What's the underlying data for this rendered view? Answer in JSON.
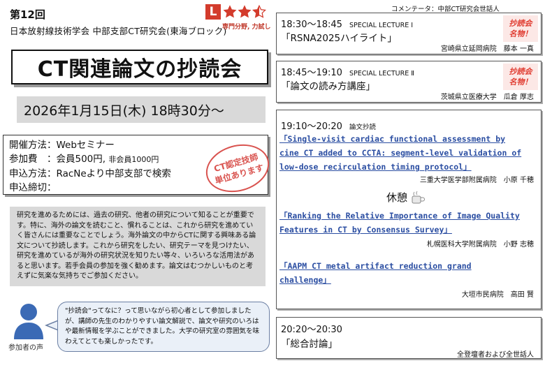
{
  "header": {
    "session_no": "第12回",
    "organizer": "日本放射線技術学会 中部支部CT研究会(東海ブロック)",
    "level_letter": "L",
    "level_stars": 2.5,
    "level_caption": "専門分野, 力試し"
  },
  "main_title": "CT関連論文の抄読会",
  "date_text": "2026年1月15日(木) 18時30分～",
  "info": {
    "method_label": "開催方法：",
    "method_value": "Webセミナー",
    "fee_label": "参加費　：",
    "fee_member": "会員500円,",
    "fee_nonmember": "非会員1000円",
    "apply_label": "申込方法：",
    "apply_value": "RacNeより中部支部で検索",
    "deadline_label": "申込締切："
  },
  "stamp": {
    "line1": "CT認定技師",
    "line2": "単位あります"
  },
  "description": "研究を進めるためには、過去の研究、他者の研究について知ることが重要です。特に、海外の論文を読むこと、慣れることは、これから研究を進めていく皆さんには重要なことでしょう。海外論文の中からCTに関する興味ある論文について抄読します。これから研究をしたい、研究テーマを見つけたい、研究を進めているが海外の研究状況を知りたい等々、いろいろな活用法があると思います。若手会員の参加を強く勧めます。論文はむつかしいものと考えずに気楽な気持ちでご参加ください。",
  "voice": {
    "label": "参加者の声",
    "text": "\"抄読会\"ってなに？って思いながら初心者として参加しましたが、講師の先生のわかりやすい論文解説で、論文や研究のいろはや最新情報を学ぶことができました。大学の研究室の雰囲気を味わえてとても楽しかったです。"
  },
  "commentator": "コメンテータ：中部CT研究会世話人",
  "lectures": [
    {
      "time": "18:30～18:45",
      "kind": "SPECIAL LECTURE Ⅰ",
      "title": "「RSNA2025ハイライト」",
      "speaker": "宮崎県立延岡病院　藤本 一真",
      "famous": "抄読会\n名物！"
    },
    {
      "time": "18:45～19:10",
      "kind": "SPECIAL LECTURE Ⅱ",
      "title": "「論文の読み方講座」",
      "speaker": "茨城県立医療大学　瓜倉 厚志",
      "famous": "抄読会\n名物！"
    }
  ],
  "papers_session": {
    "time": "19:10～20:20",
    "kind": "論文抄読",
    "break_label": "休憩",
    "papers": [
      {
        "lines": [
          "「Single-visit cardiac functional assessment by",
          "cine CT added to CCTA: segment-level validation of",
          "low-dose recirculation timing protocol」"
        ],
        "speaker": "三重大学医学部附属病院　小原 千穂"
      },
      {
        "lines": [
          "「Ranking the Relative Importance of Image Quality",
          "Features in CT by Consensus Survey」"
        ],
        "speaker": "札幌医科大学附属病院　小野 志穂"
      },
      {
        "lines": [
          "「AAPM CT metal artifact reduction grand",
          "challenge」"
        ],
        "speaker": "大垣市民病院　高田 賢"
      }
    ]
  },
  "discussion": {
    "time": "20:20～20:30",
    "title": "「総合討論」",
    "speaker": "全登壇者および全世話人"
  }
}
